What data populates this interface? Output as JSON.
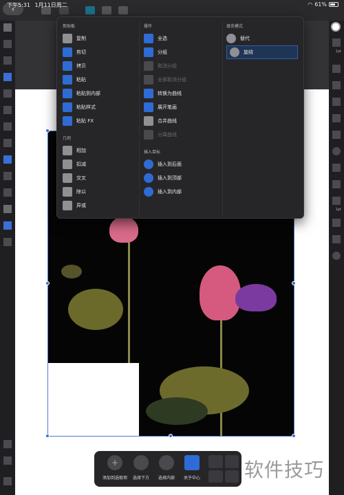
{
  "status": {
    "time": "下午5:31",
    "date": "1月11日周二",
    "battery_pct": "61%"
  },
  "menu": {
    "clipboard": {
      "title": "剪贴板",
      "items": [
        "复制",
        "剪切",
        "拷贝",
        "粘贴",
        "粘贴到内部",
        "粘贴样式",
        "粘贴 FX"
      ]
    },
    "geometry": {
      "title": "几何",
      "items": [
        "相加",
        "扣减",
        "交叉",
        "除以",
        "异或"
      ]
    },
    "operations": {
      "title": "操作",
      "items": [
        {
          "label": "全选",
          "enabled": true
        },
        {
          "label": "分组",
          "enabled": true
        },
        {
          "label": "取消分组",
          "enabled": false
        },
        {
          "label": "全部取消分组",
          "enabled": false
        },
        {
          "label": "转换为曲线",
          "enabled": true
        },
        {
          "label": "展开笔画",
          "enabled": true
        },
        {
          "label": "合并曲线",
          "enabled": true
        },
        {
          "label": "分离曲线",
          "enabled": false
        }
      ]
    },
    "insert_target": {
      "title": "插入目标",
      "items": [
        "插入到后面",
        "插入到顶部",
        "插入到内部"
      ]
    },
    "fill_mode": {
      "title": "填充模式",
      "items": [
        "替代",
        "旋绕"
      ],
      "selected": "旋绕"
    }
  },
  "bottombar": {
    "items": [
      "添加到选取项",
      "选择下方",
      "选择内部",
      "关于中心"
    ]
  },
  "watermark": "软件技巧",
  "right_panel": {
    "stroke_label": "1pt",
    "alpha_label": "1pt"
  }
}
